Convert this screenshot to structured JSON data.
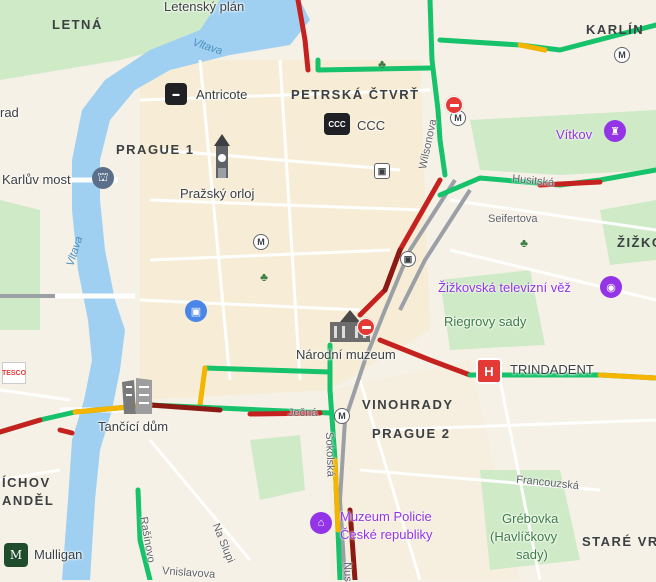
{
  "districts": {
    "letna": "LETNÁ",
    "karlin": "KARLÍN",
    "petrska": "PETRSKÁ ČTVRŤ",
    "prague1": "PRAGUE 1",
    "zizkov": "ŽIŽKO",
    "vinohrady": "VINOHRADY",
    "prague2": "PRAGUE 2",
    "smichov": "ÍCHOV",
    "andel": "ANDĚL",
    "stare_vrsovice": "STARÉ VRŠ"
  },
  "pois": {
    "letenska": "Letenský plán",
    "antricote": "Antricote",
    "ccc": "CCC",
    "karluv_most": "Karlův most",
    "orloj": "Pražský orloj",
    "vitkov": "Vítkov",
    "tv_tower": "Žižkovská televizní věž",
    "riegrovy": "Riegrovy sady",
    "narodni_muzeum": "Národní muzeum",
    "trindadent": "TRINDADENT",
    "tancici_dum": "Tančící dům",
    "museum_police_1": "Muzeum Policie",
    "museum_police_2": "České republiky",
    "grebovka_1": "Grébovka",
    "grebovka_2": "(Havlíčkovy",
    "grebovka_3": "sady)",
    "mulligan": "Mulligan",
    "rad": "rad",
    "ccc_logo": "CCC",
    "tesco": "TESCO"
  },
  "streets": {
    "wilsonova": "Wilsonova",
    "husitska": "Husitská",
    "seifertova": "Seifertova",
    "jecna": "Ječná",
    "sokolska": "Sokolská",
    "francouzska": "Francouzská",
    "na_slupi": "Na Slupi",
    "rasinovo": "Rašínovo",
    "vnislavova": "Vnislavova",
    "nus": "Nus"
  },
  "water": {
    "vltava_north": "Vltava",
    "vltava_west": "Vltava"
  },
  "metro_letter": "M",
  "colors": {
    "water": "#9fd0f2",
    "park": "#cfeac7",
    "traffic_green": "#16c26a",
    "traffic_orange": "#f4b400",
    "traffic_red": "#c5221f",
    "traffic_darkred": "#8b1a14",
    "rail": "#9aa0a6",
    "poi_purple": "#9334e6",
    "hospital": "#e53935"
  }
}
